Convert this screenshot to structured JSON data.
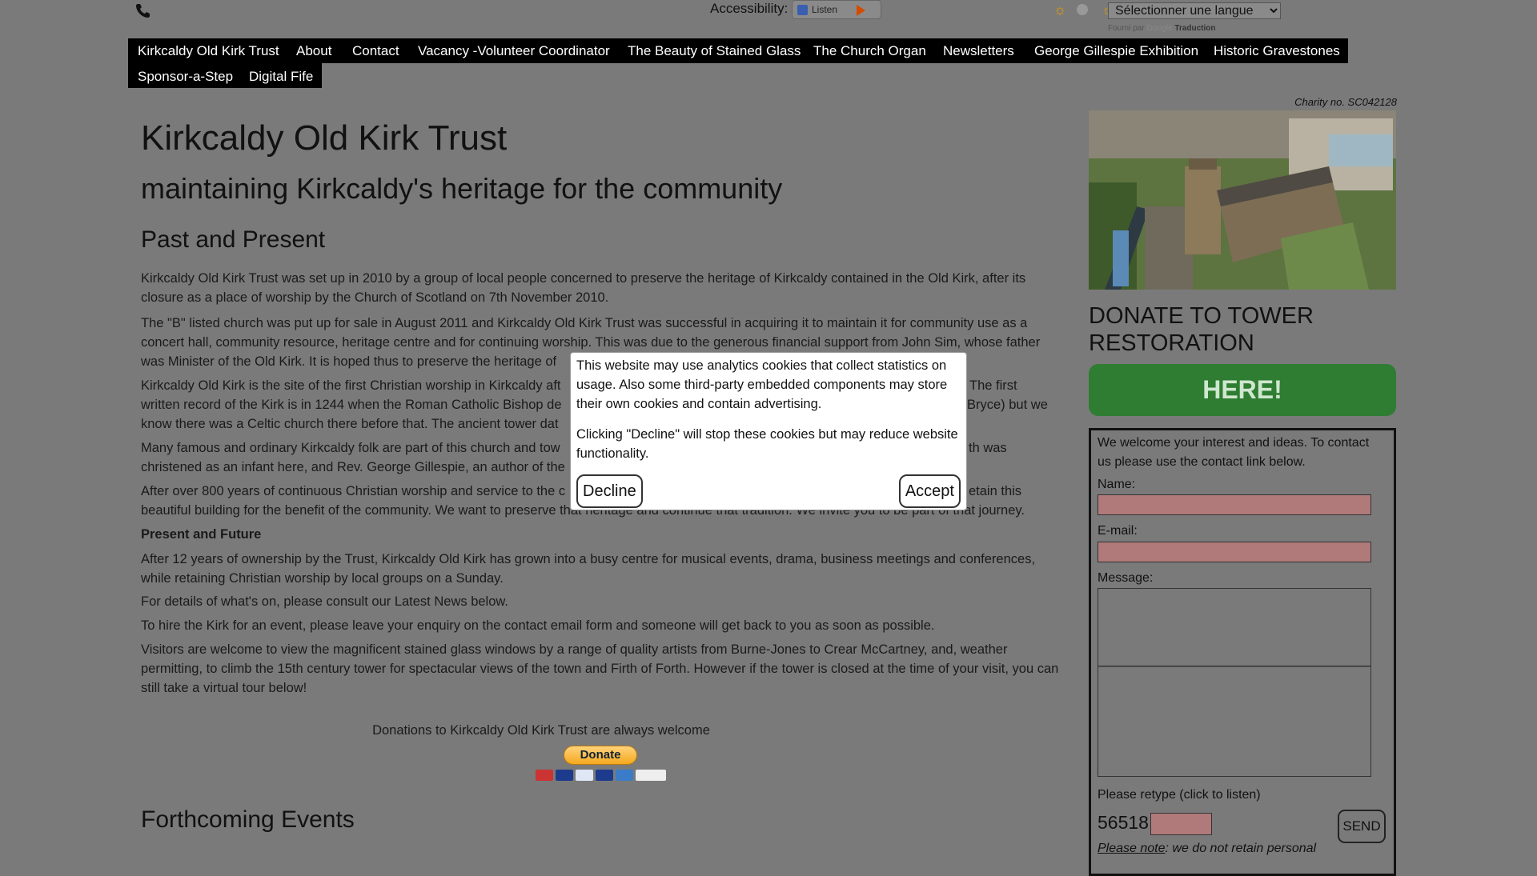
{
  "topbar": {
    "accessibility_label": "Accessibility:",
    "listen_label": "Listen",
    "language_select": "Sélectionner une langue",
    "powered_by": "Fourni par",
    "google": "Google",
    "translate": "Traduction"
  },
  "nav": {
    "items": [
      "Kirkcaldy Old Kirk Trust",
      "About",
      "Contact",
      "Vacancy -Volunteer Coordinator",
      "The Beauty of Stained Glass",
      "The Church Organ",
      "Newsletters",
      "George Gillespie Exhibition",
      "Historic Gravestones",
      "Sponsor-a-Step",
      "Digital Fife"
    ]
  },
  "main": {
    "title": "Kirkcaldy Old Kirk Trust",
    "subtitle": "maintaining Kirkcaldy's heritage for the community",
    "section1": "Past and Present",
    "paragraphs": [
      "Kirkcaldy Old Kirk Trust was set up in 2010 by a group of local people concerned to preserve the heritage of Kirkcaldy contained in the Old Kirk, after its closure as a place of worship by the Church of Scotland on 7th November 2010.",
      "The \"B\" listed church was put up for sale in August 2011 and Kirkcaldy Old Kirk Trust was successful in acquiring it to maintain it for community use as a concert hall, community resource, heritage centre and for continuing worship. This was due to the generous financial support from John Sim, whose father was Minister of the Old Kirk. It is hoped thus to preserve the heritage of",
      "Kirkcaldy Old Kirk is the site of the first Christian worship in Kirkcaldy aft",
      "The first",
      "written record of the Kirk is in 1244 when the Roman Catholic Bishop de",
      "Bryce) but we",
      "know there was a Celtic church there before that. The ancient tower dat",
      "Many famous and ordinary Kirkcaldy folk are part of this church and tow",
      "th was",
      "christened as an infant here, and Rev. George Gillespie, an author of the",
      "After over 800 years of continuous Christian worship and service to the c",
      "etain this",
      "beautiful building for the benefit of the community. We want to preserve that heritage and continue that tradition. We invite you to be part of that journey."
    ],
    "section2": "Present and Future",
    "paragraphs2": [
      "After 12 years of ownership by the Trust, Kirkcaldy Old Kirk has grown into a busy centre for musical events, drama, business meetings and conferences, while retaining Christian worship by local groups on a Sunday.",
      "For details of what's on, please consult our Latest News below.",
      "To hire the Kirk for an event, please leave your enquiry on the contact email form and someone will get back to you as soon as possible.",
      "Visitors are welcome to view the magnificent stained glass windows by a range of quality artists from Burne-Jones to Crear McCartney, and, weather permitting, to climb the 15th century tower for spectacular views of the town and Firth of Forth. However if the tower is closed at the time of your visit, you can still take a virtual tour below!"
    ],
    "donations_text": "Donations to Kirkcaldy Old Kirk Trust are always welcome",
    "donate_button": "Donate",
    "section3": "Forthcoming Events"
  },
  "sidebar": {
    "charity": "Charity no. SC042128",
    "donate_heading": "DONATE TO TOWER RESTORATION",
    "here_button": "HERE!",
    "welcome": "We welcome your interest and ideas. To contact us please use the contact link below.",
    "name_label": "Name:",
    "email_label": "E-mail:",
    "message_label": "Message:",
    "retype_label": "Please retype (click to listen)",
    "captcha": "56518",
    "send_button": "SEND",
    "note_link": "Please note",
    "note_text": ": we do not retain personal"
  },
  "modal": {
    "text1": "This website may use analytics cookies that collect statistics on usage. Also some third-party embedded components may store their own cookies and contain advertising.",
    "text2": "Clicking \"Decline\" will stop these cookies but may reduce website functionality.",
    "decline": "Decline",
    "accept": "Accept"
  },
  "colors": {
    "background": "#7a7a7a",
    "nav": "#000000",
    "here_button": "#2e7d32",
    "input": "#b07a7a"
  }
}
